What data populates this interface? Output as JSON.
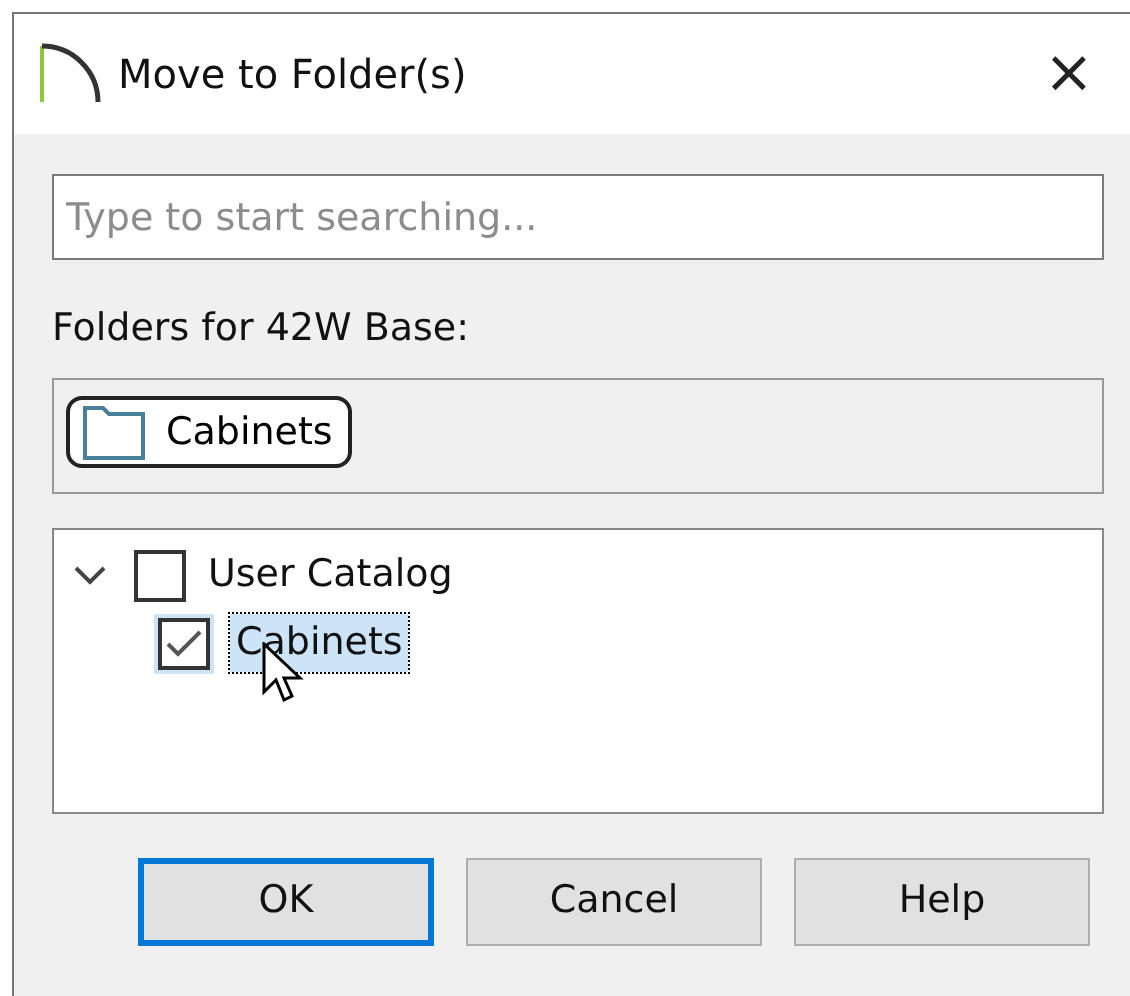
{
  "window": {
    "title": "Move to Folder(s)",
    "close": "×"
  },
  "search": {
    "placeholder": "Type to start searching..."
  },
  "folders_label": "Folders for 42W Base:",
  "folder_chips": [
    {
      "label": "Cabinets"
    }
  ],
  "tree": [
    {
      "label": "User Catalog",
      "expanded": true,
      "checked": false,
      "selected": false,
      "children": [
        {
          "label": "Cabinets",
          "checked": true,
          "selected": true
        }
      ]
    }
  ],
  "buttons": [
    {
      "label": "OK",
      "default": true
    },
    {
      "label": "Cancel",
      "default": false
    },
    {
      "label": "Help",
      "default": false
    }
  ]
}
